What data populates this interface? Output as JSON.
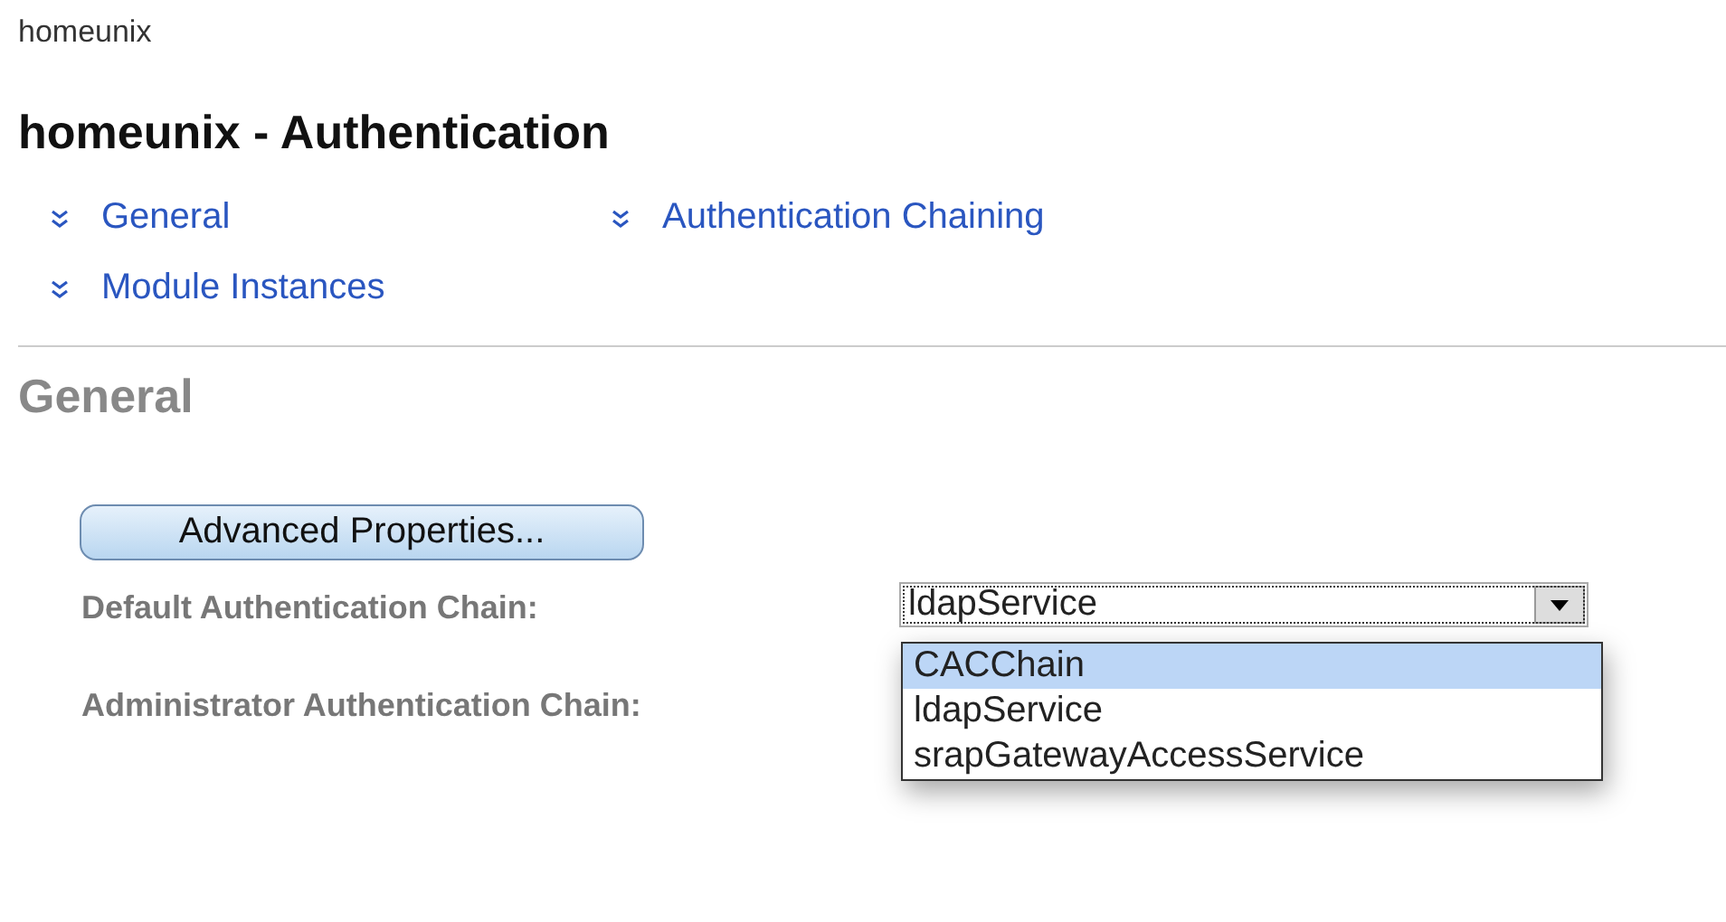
{
  "site": "homeunix",
  "page_title": "homeunix - Authentication",
  "section_links": [
    {
      "label": "General"
    },
    {
      "label": "Authentication Chaining"
    },
    {
      "label": "Module Instances"
    }
  ],
  "section": {
    "title": "General",
    "button": "Advanced Properties...",
    "fields": [
      {
        "label": "Default Authentication Chain:",
        "value": "ldapService",
        "expanded": true,
        "options": [
          {
            "label": "CACChain",
            "highlighted": true
          },
          {
            "label": "ldapService",
            "highlighted": false
          },
          {
            "label": "srapGatewayAccessService",
            "highlighted": false
          }
        ]
      },
      {
        "label": "Administrator Authentication Chain:"
      }
    ]
  }
}
